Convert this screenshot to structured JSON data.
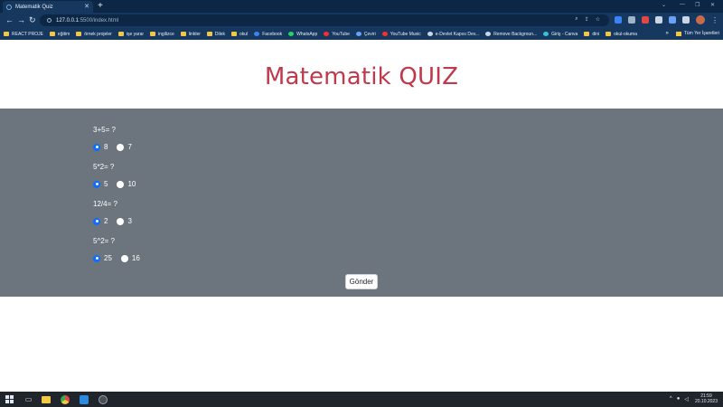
{
  "browser": {
    "tab_title": "Matematik Quiz",
    "new_tab": "+",
    "window_controls": [
      "⌄",
      "—",
      "❐",
      "✕"
    ],
    "url_host": "127.0.0.1",
    "url_rest": ":5500/index.html",
    "bookmarks": [
      {
        "label": "REACT PROJE",
        "icon": "folder-icon",
        "color": "#f2c744"
      },
      {
        "label": "eğitim",
        "icon": "folder-icon",
        "color": "#f2c744"
      },
      {
        "label": "örnek projeler",
        "icon": "folder-icon",
        "color": "#f2c744"
      },
      {
        "label": "işe yarar",
        "icon": "folder-icon",
        "color": "#f2c744"
      },
      {
        "label": "ingilizce",
        "icon": "folder-icon",
        "color": "#f2c744"
      },
      {
        "label": "linkler",
        "icon": "folder-icon",
        "color": "#f2c744"
      },
      {
        "label": "Dilek",
        "icon": "folder-icon",
        "color": "#f2c744"
      },
      {
        "label": "okul",
        "icon": "folder-icon",
        "color": "#f2c744"
      },
      {
        "label": "Facebook",
        "icon": "facebook-icon",
        "color": "#3b82f6"
      },
      {
        "label": "WhatsApp",
        "icon": "whatsapp-icon",
        "color": "#25d366"
      },
      {
        "label": "YouTube",
        "icon": "youtube-icon",
        "color": "#ff2d2d"
      },
      {
        "label": "Çeviri",
        "icon": "translate-icon",
        "color": "#6aa3f5"
      },
      {
        "label": "YouTube Music",
        "icon": "youtube-music-icon",
        "color": "#ff2d2d"
      },
      {
        "label": "e-Devlet Kapısı Dev...",
        "icon": "edevlet-icon",
        "color": "#c9d6e6"
      },
      {
        "label": "Remove Backgroun...",
        "icon": "remove-bg-icon",
        "color": "#c9d6e6"
      },
      {
        "label": "Giriş - Canva",
        "icon": "canva-icon",
        "color": "#37c3d6"
      },
      {
        "label": "dini",
        "icon": "folder-icon",
        "color": "#f2c744"
      },
      {
        "label": "okul-okuma",
        "icon": "folder-icon",
        "color": "#f2c744"
      }
    ],
    "bookmarks_more": "»",
    "other_bookmarks": "Tüm Yer İşaretleri"
  },
  "page": {
    "title": "Matematik QUIZ",
    "submit_label": "Gönder",
    "questions": [
      {
        "text": "3+5= ?",
        "options": [
          {
            "label": "8",
            "checked": true
          },
          {
            "label": "7",
            "checked": false
          }
        ]
      },
      {
        "text": "5*2= ?",
        "options": [
          {
            "label": "5",
            "checked": true
          },
          {
            "label": "10",
            "checked": false
          }
        ]
      },
      {
        "text": "12/4= ?",
        "options": [
          {
            "label": "2",
            "checked": true
          },
          {
            "label": "3",
            "checked": false
          }
        ]
      },
      {
        "text": "5^2= ?",
        "options": [
          {
            "label": "25",
            "checked": true
          },
          {
            "label": "16",
            "checked": false
          }
        ]
      }
    ]
  },
  "taskbar": {
    "time": "21:59",
    "date": "20.10.2023"
  },
  "colors": {
    "title": "#c0394b",
    "quiz_bg": "#6c757d",
    "radio_checked": "#0d6efd"
  }
}
